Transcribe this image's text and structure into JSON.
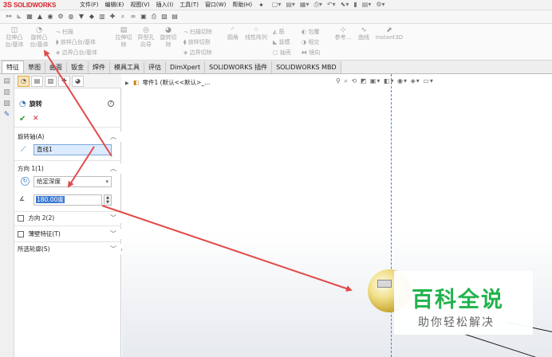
{
  "app": {
    "brand_ds": "3S",
    "brand_name": "SOLIDWORKS"
  },
  "menu": [
    "文件(F)",
    "编辑(E)",
    "视图(V)",
    "插入(I)",
    "工具(T)",
    "窗口(W)",
    "帮助(H)"
  ],
  "ribbon": {
    "extrude_boss": "拉伸凸\n台/基体",
    "revolve_boss": "旋转凸\n台/基体",
    "sweep": "扫描",
    "loft": "放样凸台/基体",
    "boundary": "边界凸台/基体",
    "extrude_cut": "拉伸切\n除",
    "hole_wizard": "异型孔\n向导",
    "revolve_cut": "旋转切\n除",
    "swept_cut": "扫描切除",
    "lofted_cut": "放样切割",
    "boundary_cut": "边界切除",
    "fillet": "圆角",
    "linear_pattern": "线性阵列",
    "rib": "筋",
    "draft": "拔模",
    "shell": "抽壳",
    "wrap": "包覆",
    "intersect": "相交",
    "mirror": "镜向",
    "ref_geometry": "参考...",
    "curves": "曲线",
    "instant3d": "Instant3D"
  },
  "tabs": [
    "特征",
    "草图",
    "曲面",
    "钣金",
    "焊件",
    "模具工具",
    "评估",
    "DimXpert",
    "SOLIDWORKS 插件",
    "SOLIDWORKS MBD"
  ],
  "active_tab": "特征",
  "property_manager": {
    "title": "旋转",
    "help_symbol": "?",
    "ok_symbol": "✔",
    "cancel_symbol": "✕",
    "axis_section": "旋转轴(A)",
    "axis_value": "直线1",
    "direction1_section": "方向 1(1)",
    "direction1_type": "给定深度",
    "angle_value": "180.00度",
    "direction2_section": "方向 2(2)",
    "thin_feature_section": "薄壁特征(T)",
    "selected_contours_section": "所选轮廓(S)"
  },
  "viewport": {
    "tree_item": "零件1  (默认<<默认>_..."
  },
  "watermark": {
    "title": "百科全说",
    "subtitle": "助你轻松解决"
  },
  "colors": {
    "brand_red": "#d7232a",
    "accent_blue": "#3a78d2",
    "arrow_red": "#e24a4a",
    "watermark_green": "#22b34c"
  }
}
